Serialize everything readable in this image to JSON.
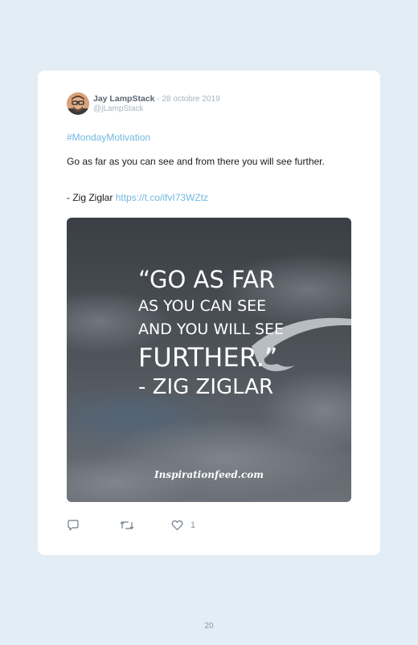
{
  "tweet": {
    "author_name": "Jay LampStack",
    "separator": " - ",
    "date": "28 octobre 2019",
    "handle": "@jLampStack",
    "hashtag": "#MondayMotivation",
    "text": "Go as far as you can see and from there you will see further.",
    "attribution": "- Zig Ziglar",
    "link": "https://t.co/ifvI73WZtz",
    "likes": "1"
  },
  "media": {
    "quote_lines": [
      "“GO AS FAR",
      "AS YOU CAN SEE",
      "AND YOU WILL SEE",
      "FURTHER.”",
      "- ZIG ZIGLAR"
    ],
    "brand": "Inspirationfeed.com"
  },
  "actions": {
    "reply_icon": "reply-icon",
    "retweet_icon": "retweet-icon",
    "like_icon": "heart-icon"
  },
  "page": {
    "number": "20"
  },
  "colors": {
    "background": "#e2edf5",
    "card": "#ffffff",
    "link": "#6fb8df",
    "muted": "#aab4bd",
    "text": "#1a1a1a"
  }
}
